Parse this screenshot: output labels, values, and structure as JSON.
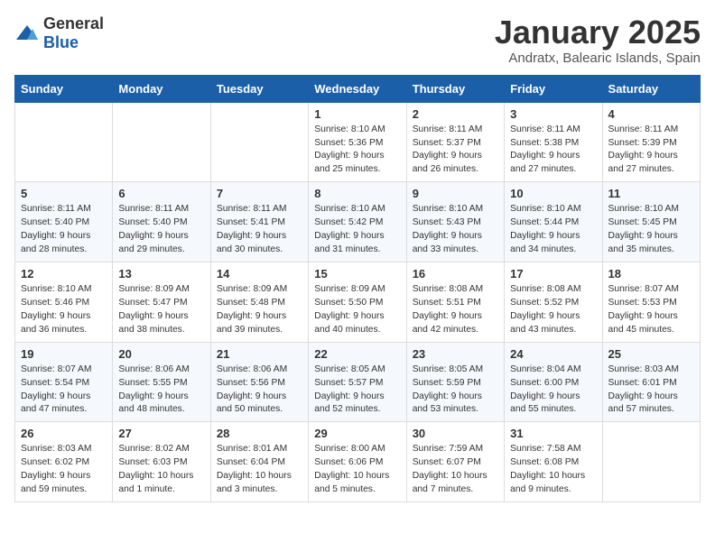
{
  "logo": {
    "general": "General",
    "blue": "Blue"
  },
  "header": {
    "month": "January 2025",
    "location": "Andratx, Balearic Islands, Spain"
  },
  "weekdays": [
    "Sunday",
    "Monday",
    "Tuesday",
    "Wednesday",
    "Thursday",
    "Friday",
    "Saturday"
  ],
  "weeks": [
    [
      {
        "day": "",
        "content": ""
      },
      {
        "day": "",
        "content": ""
      },
      {
        "day": "",
        "content": ""
      },
      {
        "day": "1",
        "content": "Sunrise: 8:10 AM\nSunset: 5:36 PM\nDaylight: 9 hours and 25 minutes."
      },
      {
        "day": "2",
        "content": "Sunrise: 8:11 AM\nSunset: 5:37 PM\nDaylight: 9 hours and 26 minutes."
      },
      {
        "day": "3",
        "content": "Sunrise: 8:11 AM\nSunset: 5:38 PM\nDaylight: 9 hours and 27 minutes."
      },
      {
        "day": "4",
        "content": "Sunrise: 8:11 AM\nSunset: 5:39 PM\nDaylight: 9 hours and 27 minutes."
      }
    ],
    [
      {
        "day": "5",
        "content": "Sunrise: 8:11 AM\nSunset: 5:40 PM\nDaylight: 9 hours and 28 minutes."
      },
      {
        "day": "6",
        "content": "Sunrise: 8:11 AM\nSunset: 5:40 PM\nDaylight: 9 hours and 29 minutes."
      },
      {
        "day": "7",
        "content": "Sunrise: 8:11 AM\nSunset: 5:41 PM\nDaylight: 9 hours and 30 minutes."
      },
      {
        "day": "8",
        "content": "Sunrise: 8:10 AM\nSunset: 5:42 PM\nDaylight: 9 hours and 31 minutes."
      },
      {
        "day": "9",
        "content": "Sunrise: 8:10 AM\nSunset: 5:43 PM\nDaylight: 9 hours and 33 minutes."
      },
      {
        "day": "10",
        "content": "Sunrise: 8:10 AM\nSunset: 5:44 PM\nDaylight: 9 hours and 34 minutes."
      },
      {
        "day": "11",
        "content": "Sunrise: 8:10 AM\nSunset: 5:45 PM\nDaylight: 9 hours and 35 minutes."
      }
    ],
    [
      {
        "day": "12",
        "content": "Sunrise: 8:10 AM\nSunset: 5:46 PM\nDaylight: 9 hours and 36 minutes."
      },
      {
        "day": "13",
        "content": "Sunrise: 8:09 AM\nSunset: 5:47 PM\nDaylight: 9 hours and 38 minutes."
      },
      {
        "day": "14",
        "content": "Sunrise: 8:09 AM\nSunset: 5:48 PM\nDaylight: 9 hours and 39 minutes."
      },
      {
        "day": "15",
        "content": "Sunrise: 8:09 AM\nSunset: 5:50 PM\nDaylight: 9 hours and 40 minutes."
      },
      {
        "day": "16",
        "content": "Sunrise: 8:08 AM\nSunset: 5:51 PM\nDaylight: 9 hours and 42 minutes."
      },
      {
        "day": "17",
        "content": "Sunrise: 8:08 AM\nSunset: 5:52 PM\nDaylight: 9 hours and 43 minutes."
      },
      {
        "day": "18",
        "content": "Sunrise: 8:07 AM\nSunset: 5:53 PM\nDaylight: 9 hours and 45 minutes."
      }
    ],
    [
      {
        "day": "19",
        "content": "Sunrise: 8:07 AM\nSunset: 5:54 PM\nDaylight: 9 hours and 47 minutes."
      },
      {
        "day": "20",
        "content": "Sunrise: 8:06 AM\nSunset: 5:55 PM\nDaylight: 9 hours and 48 minutes."
      },
      {
        "day": "21",
        "content": "Sunrise: 8:06 AM\nSunset: 5:56 PM\nDaylight: 9 hours and 50 minutes."
      },
      {
        "day": "22",
        "content": "Sunrise: 8:05 AM\nSunset: 5:57 PM\nDaylight: 9 hours and 52 minutes."
      },
      {
        "day": "23",
        "content": "Sunrise: 8:05 AM\nSunset: 5:59 PM\nDaylight: 9 hours and 53 minutes."
      },
      {
        "day": "24",
        "content": "Sunrise: 8:04 AM\nSunset: 6:00 PM\nDaylight: 9 hours and 55 minutes."
      },
      {
        "day": "25",
        "content": "Sunrise: 8:03 AM\nSunset: 6:01 PM\nDaylight: 9 hours and 57 minutes."
      }
    ],
    [
      {
        "day": "26",
        "content": "Sunrise: 8:03 AM\nSunset: 6:02 PM\nDaylight: 9 hours and 59 minutes."
      },
      {
        "day": "27",
        "content": "Sunrise: 8:02 AM\nSunset: 6:03 PM\nDaylight: 10 hours and 1 minute."
      },
      {
        "day": "28",
        "content": "Sunrise: 8:01 AM\nSunset: 6:04 PM\nDaylight: 10 hours and 3 minutes."
      },
      {
        "day": "29",
        "content": "Sunrise: 8:00 AM\nSunset: 6:06 PM\nDaylight: 10 hours and 5 minutes."
      },
      {
        "day": "30",
        "content": "Sunrise: 7:59 AM\nSunset: 6:07 PM\nDaylight: 10 hours and 7 minutes."
      },
      {
        "day": "31",
        "content": "Sunrise: 7:58 AM\nSunset: 6:08 PM\nDaylight: 10 hours and 9 minutes."
      },
      {
        "day": "",
        "content": ""
      }
    ]
  ]
}
